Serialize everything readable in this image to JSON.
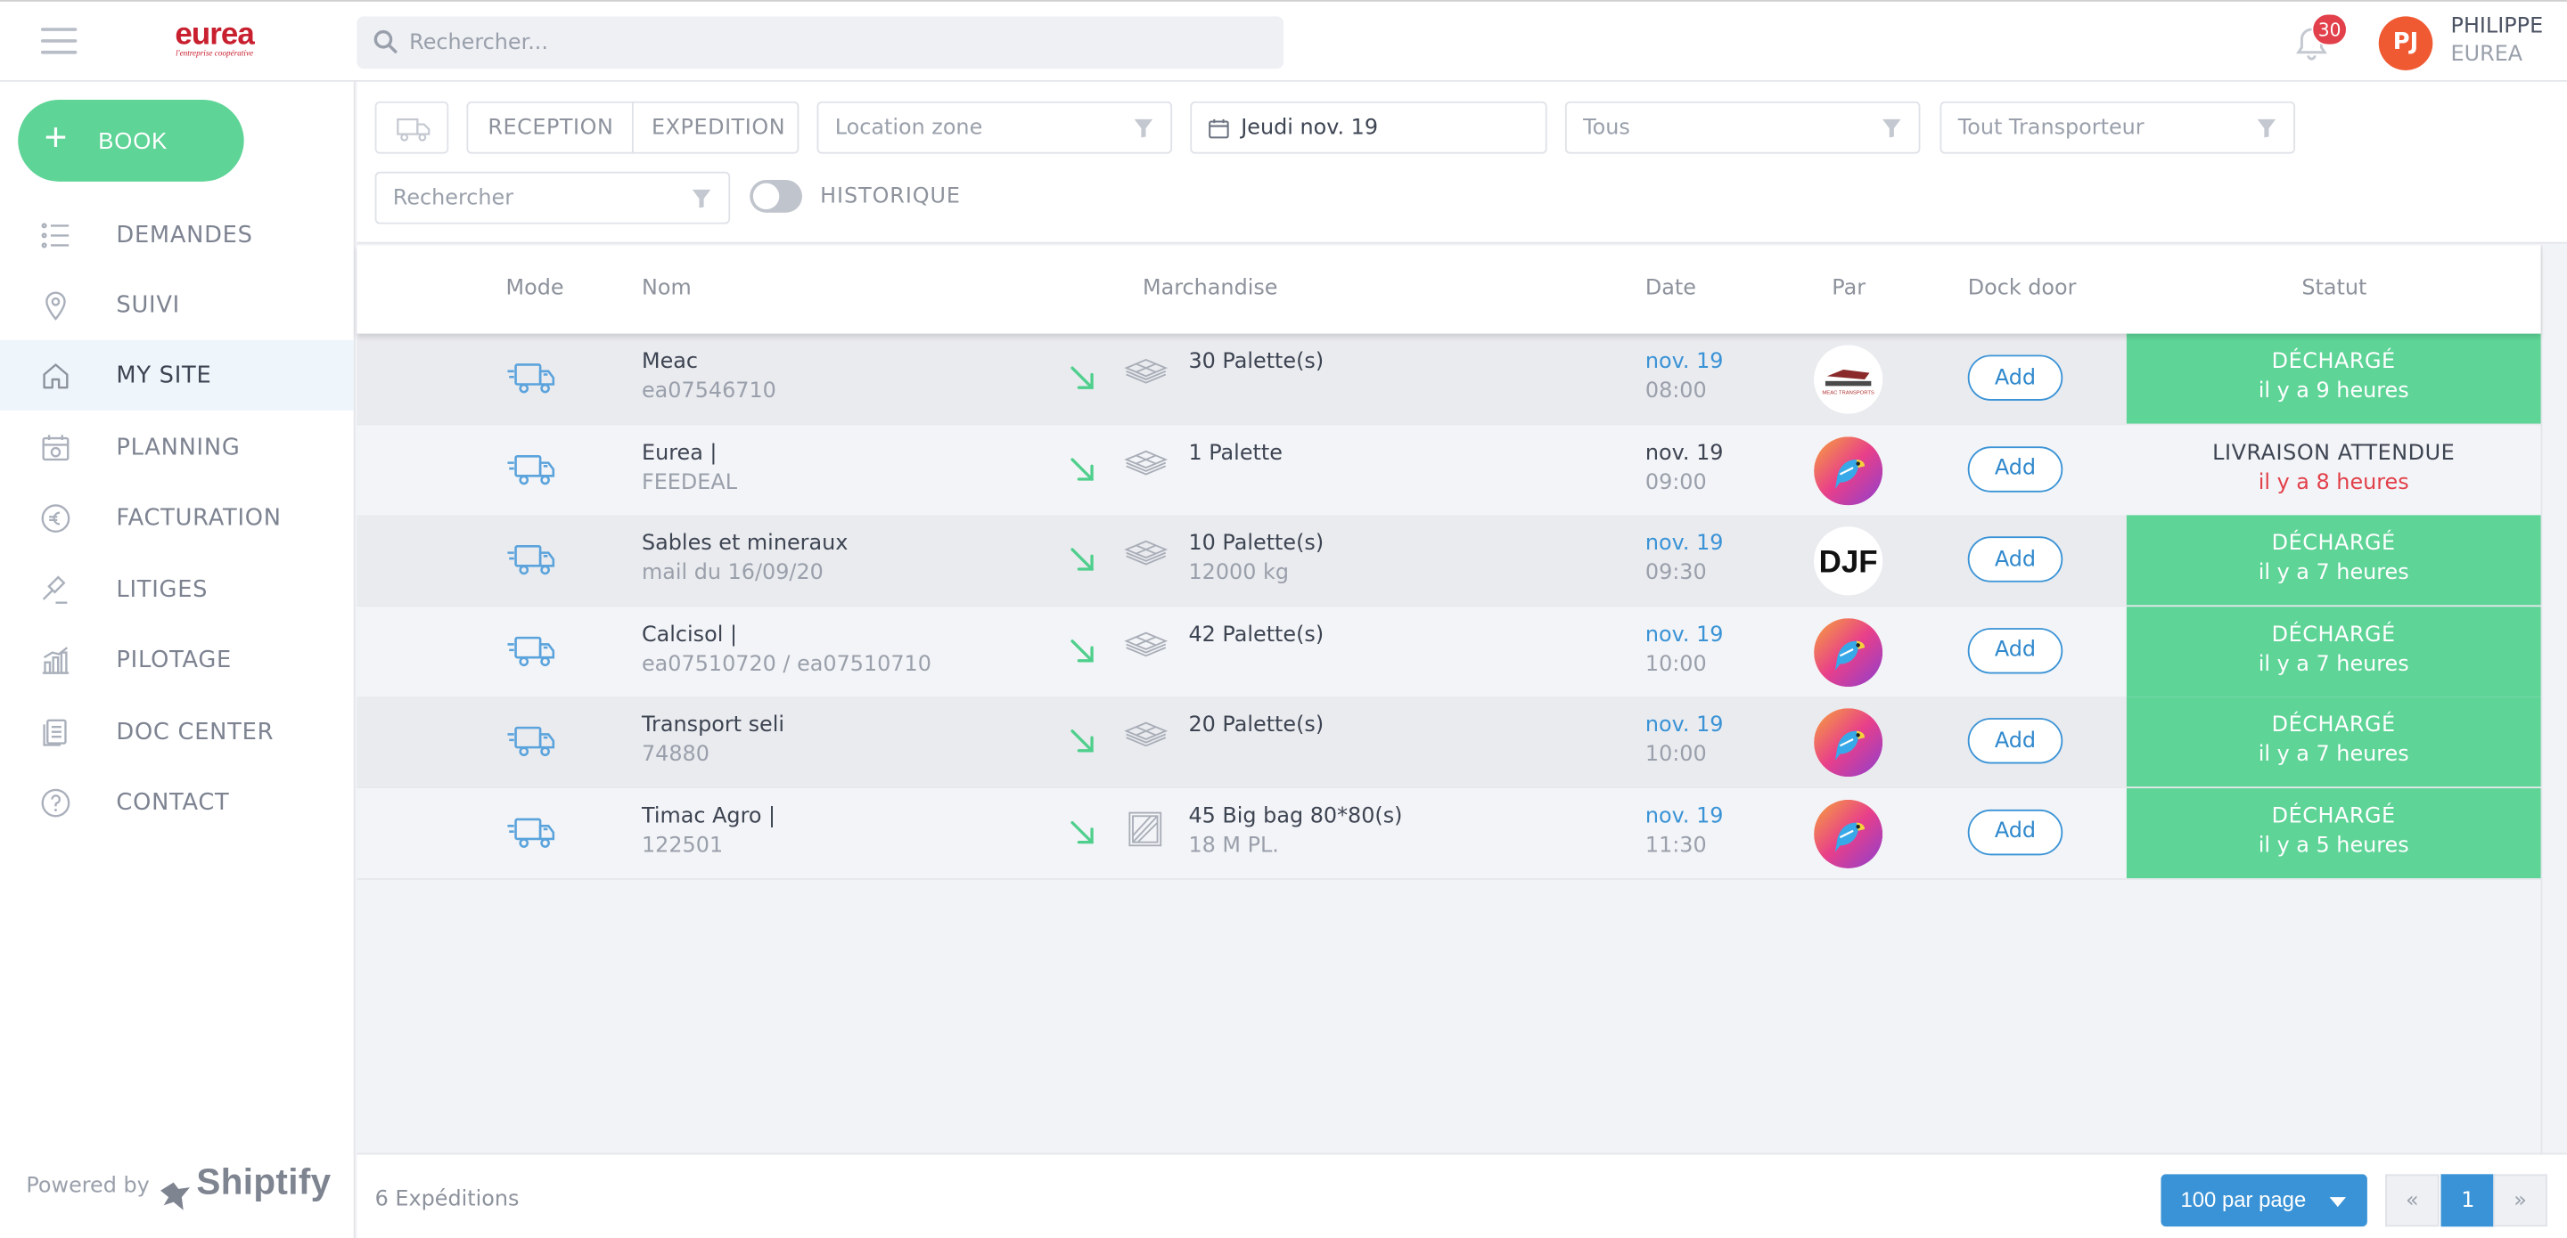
{
  "header": {
    "logo_word": "eurea",
    "logo_tag": "l'entreprise coopérative",
    "search_placeholder": "Rechercher...",
    "notification_count": "30",
    "avatar_initials": "PJ",
    "user_name": "PHILIPPE",
    "user_org": "EUREA"
  },
  "sidebar": {
    "book_label": "BOOK",
    "items": [
      {
        "label": "DEMANDES",
        "icon": "list-icon"
      },
      {
        "label": "SUIVI",
        "icon": "location-pin-icon"
      },
      {
        "label": "MY SITE",
        "icon": "home-icon"
      },
      {
        "label": "PLANNING",
        "icon": "calendar-icon"
      },
      {
        "label": "FACTURATION",
        "icon": "euro-icon"
      },
      {
        "label": "LITIGES",
        "icon": "gavel-icon"
      },
      {
        "label": "PILOTAGE",
        "icon": "chart-icon"
      },
      {
        "label": "DOC CENTER",
        "icon": "documents-icon"
      },
      {
        "label": "CONTACT",
        "icon": "question-icon"
      }
    ],
    "active_item": "MY SITE",
    "powered_by": "Powered by",
    "brand": "Shiptify"
  },
  "filters": {
    "reception": "RECEPTION",
    "expedition": "EXPEDITION",
    "location_zone": "Location zone",
    "date": "Jeudi nov. 19",
    "status": "Tous",
    "carrier": "Tout Transporteur",
    "search": "Rechercher",
    "history_label": "HISTORIQUE"
  },
  "table": {
    "columns": [
      "Mode",
      "Nom",
      "Marchandise",
      "Date",
      "Par",
      "Dock door",
      "Statut"
    ],
    "add_label": "Add",
    "rows": [
      {
        "nom": "Meac",
        "ref": "ea07546710",
        "goods": "30 Palette(s)",
        "goods_sub": "",
        "goods_icon": "pallet-icon",
        "date": "nov. 19",
        "time": "08:00",
        "par": "meac-logo",
        "status": "DÉCHARGÉ",
        "status_sub": "il y a 9 heures",
        "status_color": "green"
      },
      {
        "nom": "Eurea |",
        "ref": "FEEDEAL",
        "goods": "1 Palette",
        "goods_sub": "",
        "goods_icon": "pallet-icon",
        "date": "nov. 19",
        "time": "09:00",
        "par": "parrot-logo",
        "status": "LIVRAISON ATTENDUE",
        "status_sub": "il y a 8 heures",
        "status_color": "none"
      },
      {
        "nom": "Sables et mineraux",
        "ref": "mail du 16/09/20",
        "goods": "10 Palette(s)",
        "goods_sub": "12000 kg",
        "goods_icon": "pallet-icon",
        "date": "nov. 19",
        "time": "09:30",
        "par": "djf-logo",
        "status": "DÉCHARGÉ",
        "status_sub": "il y a 7 heures",
        "status_color": "green"
      },
      {
        "nom": "Calcisol |",
        "ref": "ea07510720 / ea07510710",
        "goods": "42 Palette(s)",
        "goods_sub": "",
        "goods_icon": "pallet-icon",
        "date": "nov. 19",
        "time": "10:00",
        "par": "parrot-logo",
        "status": "DÉCHARGÉ",
        "status_sub": "il y a 7 heures",
        "status_color": "green"
      },
      {
        "nom": "Transport seli",
        "ref": "74880",
        "goods": "20 Palette(s)",
        "goods_sub": "",
        "goods_icon": "pallet-icon",
        "date": "nov. 19",
        "time": "10:00",
        "par": "parrot-logo",
        "status": "DÉCHARGÉ",
        "status_sub": "il y a 7 heures",
        "status_color": "green"
      },
      {
        "nom": "Timac Agro |",
        "ref": "122501",
        "goods": "45 Big bag 80*80(s)",
        "goods_sub": "18 M PL.",
        "goods_icon": "bigbag-icon",
        "date": "nov. 19",
        "time": "11:30",
        "par": "parrot-logo",
        "status": "DÉCHARGÉ",
        "status_sub": "il y a 5 heures",
        "status_color": "green"
      }
    ]
  },
  "footer": {
    "count": "6 Expéditions",
    "per_page": "100 par page",
    "prev": "«",
    "page": "1",
    "next": "»"
  },
  "colors": {
    "accent_green": "#5ed497",
    "accent_blue": "#3a93d6",
    "alert_red": "#e2404a",
    "brand_red": "#c8202f",
    "avatar_orange": "#f05a32"
  },
  "par_logos": {
    "meac_text": "MEAC TRANSPORTS",
    "djf_text": "DJF"
  }
}
